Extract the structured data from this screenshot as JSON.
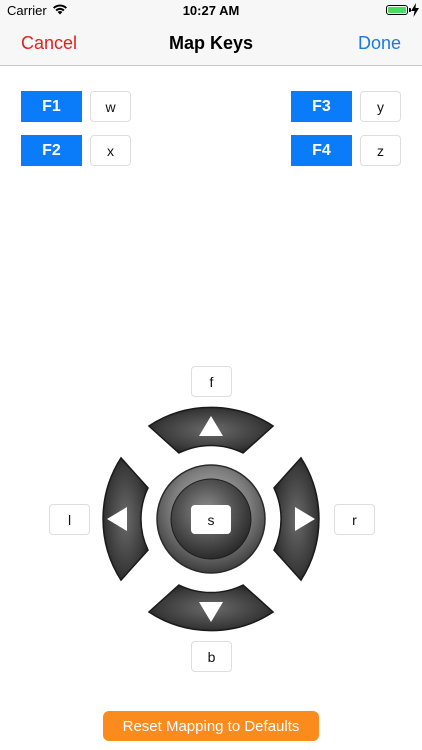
{
  "status_bar": {
    "carrier": "Carrier",
    "time": "10:27 AM",
    "battery_level": 1.0
  },
  "nav": {
    "cancel": "Cancel",
    "title": "Map Keys",
    "done": "Done"
  },
  "function_keys": [
    {
      "label": "F1",
      "mapping": "w"
    },
    {
      "label": "F2",
      "mapping": "x"
    },
    {
      "label": "F3",
      "mapping": "y"
    },
    {
      "label": "F4",
      "mapping": "z"
    }
  ],
  "dpad": {
    "forward": "f",
    "left": "l",
    "right": "r",
    "back": "b",
    "center": "s"
  },
  "reset_button": "Reset Mapping to Defaults",
  "colors": {
    "cancel": "#e1211e",
    "done": "#1b7ae0",
    "function_key": "#0a7cf9",
    "reset_button": "#fb8b1c"
  },
  "icons": [
    "wifi-icon",
    "battery-icon",
    "charging-bolt-icon",
    "arrow-up-icon",
    "arrow-left-icon",
    "arrow-right-icon",
    "arrow-down-icon"
  ]
}
